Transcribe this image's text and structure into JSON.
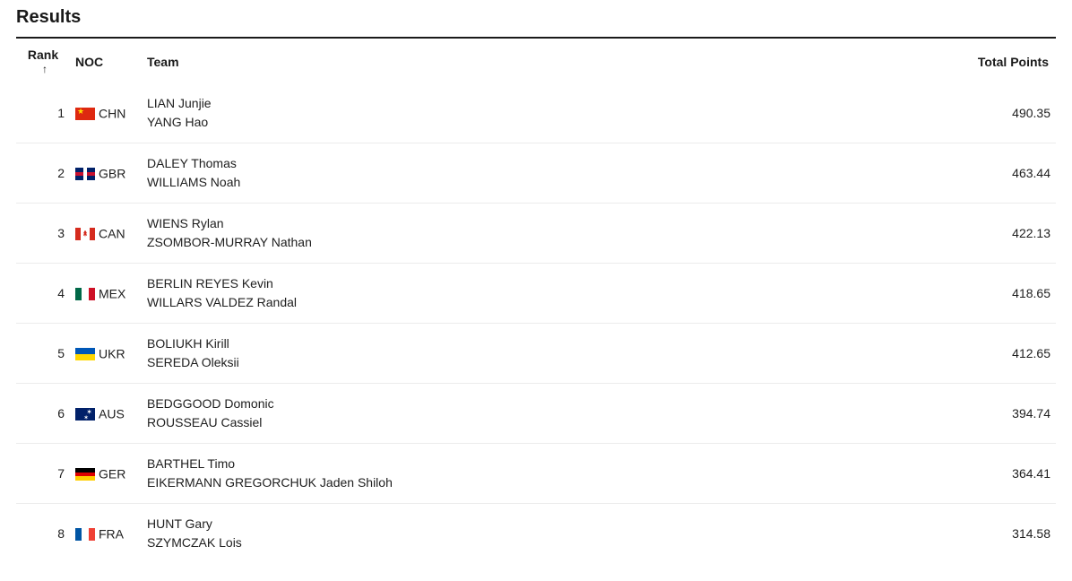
{
  "title": "Results",
  "columns": {
    "rank": "Rank",
    "noc": "NOC",
    "team": "Team",
    "points": "Total Points"
  },
  "sort_indicator": "↑",
  "rows": [
    {
      "rank": "1",
      "noc": "CHN",
      "team1": "LIAN Junjie",
      "team2": "YANG Hao",
      "points": "490.35"
    },
    {
      "rank": "2",
      "noc": "GBR",
      "team1": "DALEY Thomas",
      "team2": "WILLIAMS Noah",
      "points": "463.44"
    },
    {
      "rank": "3",
      "noc": "CAN",
      "team1": "WIENS Rylan",
      "team2": "ZSOMBOR-MURRAY Nathan",
      "points": "422.13"
    },
    {
      "rank": "4",
      "noc": "MEX",
      "team1": "BERLIN REYES Kevin",
      "team2": "WILLARS VALDEZ Randal",
      "points": "418.65"
    },
    {
      "rank": "5",
      "noc": "UKR",
      "team1": "BOLIUKH Kirill",
      "team2": "SEREDA Oleksii",
      "points": "412.65"
    },
    {
      "rank": "6",
      "noc": "AUS",
      "team1": "BEDGGOOD Domonic",
      "team2": "ROUSSEAU Cassiel",
      "points": "394.74"
    },
    {
      "rank": "7",
      "noc": "GER",
      "team1": "BARTHEL Timo",
      "team2": "EIKERMANN GREGORCHUK Jaden Shiloh",
      "points": "364.41"
    },
    {
      "rank": "8",
      "noc": "FRA",
      "team1": "HUNT Gary",
      "team2": "SZYMCZAK Lois",
      "points": "314.58"
    }
  ]
}
